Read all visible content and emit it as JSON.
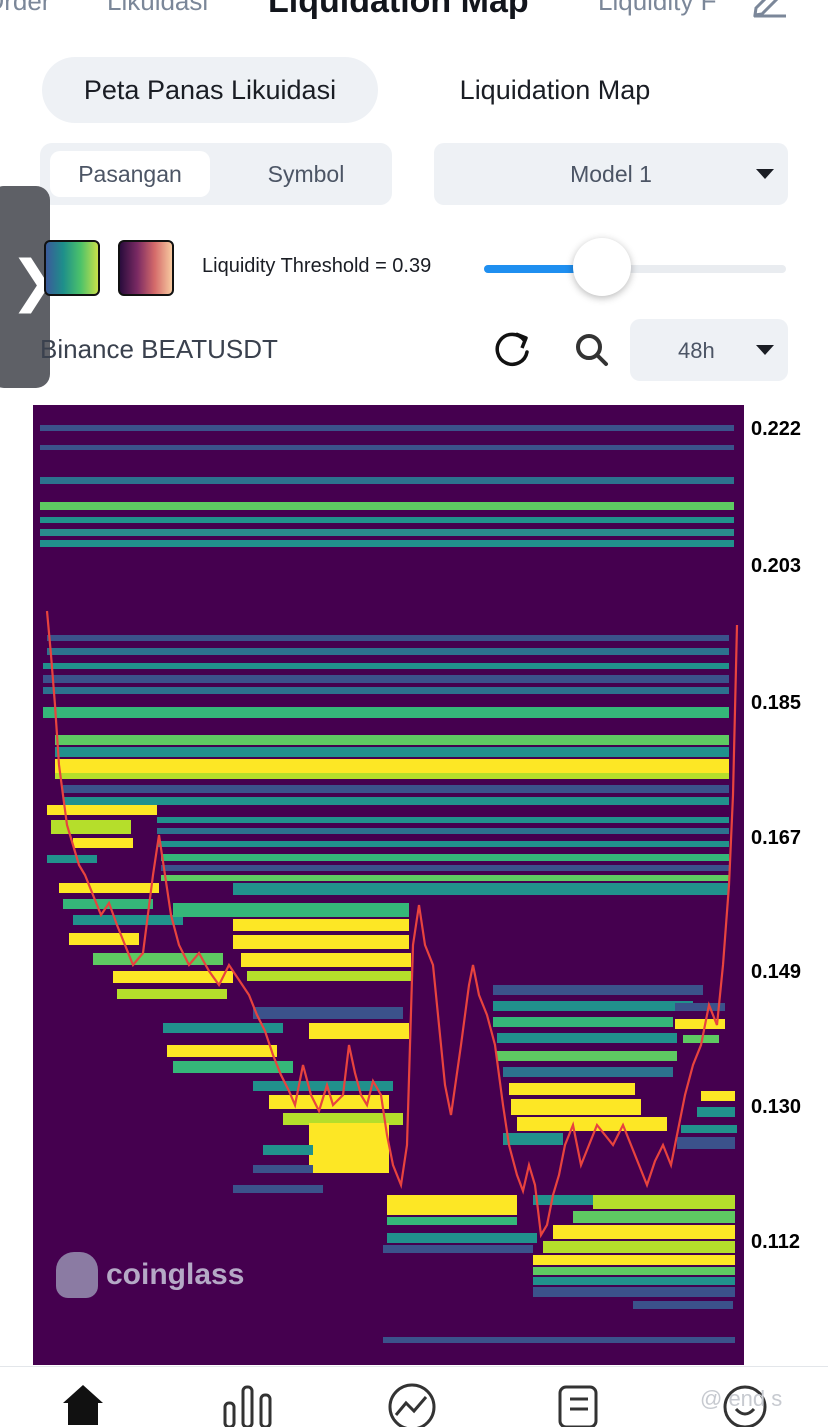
{
  "top_tabs": [
    {
      "label": "Order"
    },
    {
      "label": "Likuidasi"
    },
    {
      "label": "Liquidation Map"
    },
    {
      "label": "Liquidity F"
    }
  ],
  "view_tabs": {
    "heatmap": "Peta Panas Likuidasi",
    "map": "Liquidation Map"
  },
  "pair_toggle": {
    "options": [
      "Pasangan",
      "Symbol"
    ],
    "selected": "Pasangan"
  },
  "model_select": {
    "value": "Model 1"
  },
  "threshold": {
    "label": "Liquidity Threshold = 0.39",
    "value": 0.39
  },
  "exchange": "Binance BEATUSDT",
  "timeframe": {
    "value": "48h"
  },
  "heatmap": {
    "y_ticks": [
      "0.222",
      "0.203",
      "0.185",
      "0.167",
      "0.149",
      "0.130",
      "0.112"
    ],
    "colors": {
      "background": "#45004f",
      "low": "#3b528b",
      "mid": "#21918c",
      "high": "#5ec962",
      "max": "#fde725",
      "candle_down": "#e8433e",
      "candle_up": "#3ab08d"
    }
  },
  "watermark": "coinglass",
  "corner_text": "@ end s",
  "bottom_nav": [
    {
      "icon": "home-icon"
    },
    {
      "icon": "bar-chart-icon"
    },
    {
      "icon": "trend-icon"
    },
    {
      "icon": "news-icon"
    },
    {
      "icon": "coin-icon"
    }
  ]
}
